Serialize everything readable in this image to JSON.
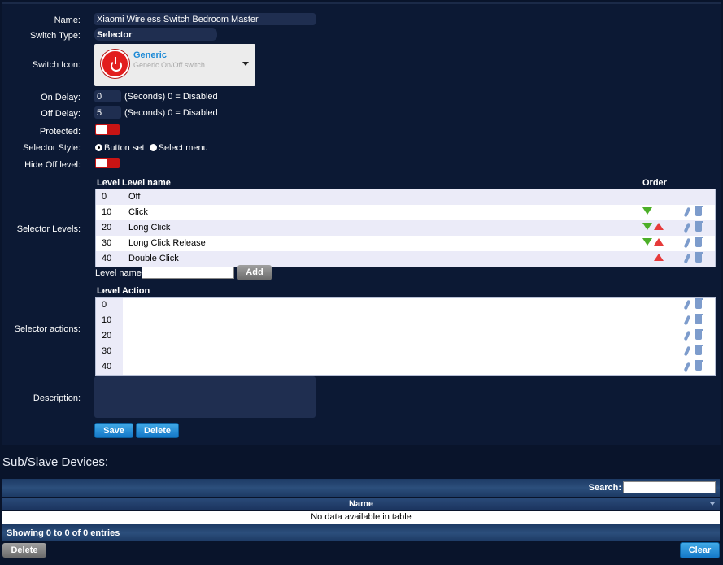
{
  "form": {
    "name_label": "Name:",
    "name_value": "Xiaomi Wireless Switch Bedroom Master",
    "switch_type_label": "Switch Type:",
    "switch_type_value": "Selector",
    "switch_icon_label": "Switch Icon:",
    "icon_title": "Generic",
    "icon_subtitle": "Generic On/Off switch",
    "on_delay_label": "On Delay:",
    "on_delay_value": "0",
    "off_delay_label": "Off Delay:",
    "off_delay_value": "5",
    "delay_note": "(Seconds) 0 = Disabled",
    "protected_label": "Protected:",
    "selector_style_label": "Selector Style:",
    "selector_style_opt1": "Button set",
    "selector_style_opt2": "Select menu",
    "hide_off_label": "Hide Off level:",
    "selector_levels_label": "Selector Levels:",
    "levels_header": {
      "level": "Level",
      "name": "Level name",
      "order": "Order"
    },
    "levels": [
      {
        "level": "0",
        "name": "Off"
      },
      {
        "level": "10",
        "name": "Click"
      },
      {
        "level": "20",
        "name": "Long Click"
      },
      {
        "level": "30",
        "name": "Long Click Release"
      },
      {
        "level": "40",
        "name": "Double Click"
      }
    ],
    "level_name_label": "Level name:",
    "add_label": "Add",
    "selector_actions_label": "Selector actions:",
    "actions_header": {
      "level": "Level",
      "action": "Action"
    },
    "actions": [
      {
        "level": "0"
      },
      {
        "level": "10"
      },
      {
        "level": "20"
      },
      {
        "level": "30"
      },
      {
        "level": "40"
      }
    ],
    "description_label": "Description:",
    "save_label": "Save",
    "delete_label": "Delete"
  },
  "sub_devices": {
    "title": "Sub/Slave Devices:",
    "search_label": "Search:",
    "column_name": "Name",
    "empty_text": "No data available in table",
    "info_text": "Showing 0 to 0 of 0 entries",
    "delete_label": "Delete",
    "clear_label": "Clear"
  },
  "colors": {
    "accent": "#1478c8",
    "toggle": "#c81414",
    "background": "#09142b"
  }
}
